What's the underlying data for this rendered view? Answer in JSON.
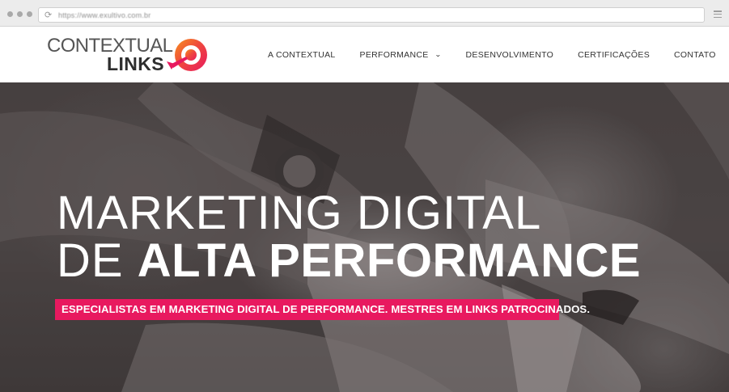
{
  "browser": {
    "url": "https://www.exultivo.com.br",
    "reload_icon": "reload-icon",
    "menu_icon": "hamburger-menu-icon"
  },
  "logo": {
    "line1": "CONTEXTUAL",
    "line2": "LINKS",
    "mark_icon": "target-arrow-icon",
    "colors": {
      "gradient_start": "#e8195f",
      "gradient_end": "#f7931e"
    }
  },
  "nav": {
    "items": [
      {
        "label": "A CONTEXTUAL"
      },
      {
        "label": "PERFORMANCE",
        "has_dropdown": true
      },
      {
        "label": "DESENVOLVIMENTO"
      },
      {
        "label": "CERTIFICAÇÕES"
      },
      {
        "label": "CONTATO"
      }
    ],
    "dropdown_icon": "chevron-down-icon"
  },
  "hero": {
    "title_line1": "MARKETING DIGITAL",
    "title_line2_light": "DE",
    "title_line2_bold": "ALTA PERFORMANCE",
    "tagline": "ESPECIALISTAS EM MARKETING DIGITAL DE PERFORMANCE. MESTRES EM LINKS PATROCINADOS.",
    "accent_color": "#e8195f"
  }
}
